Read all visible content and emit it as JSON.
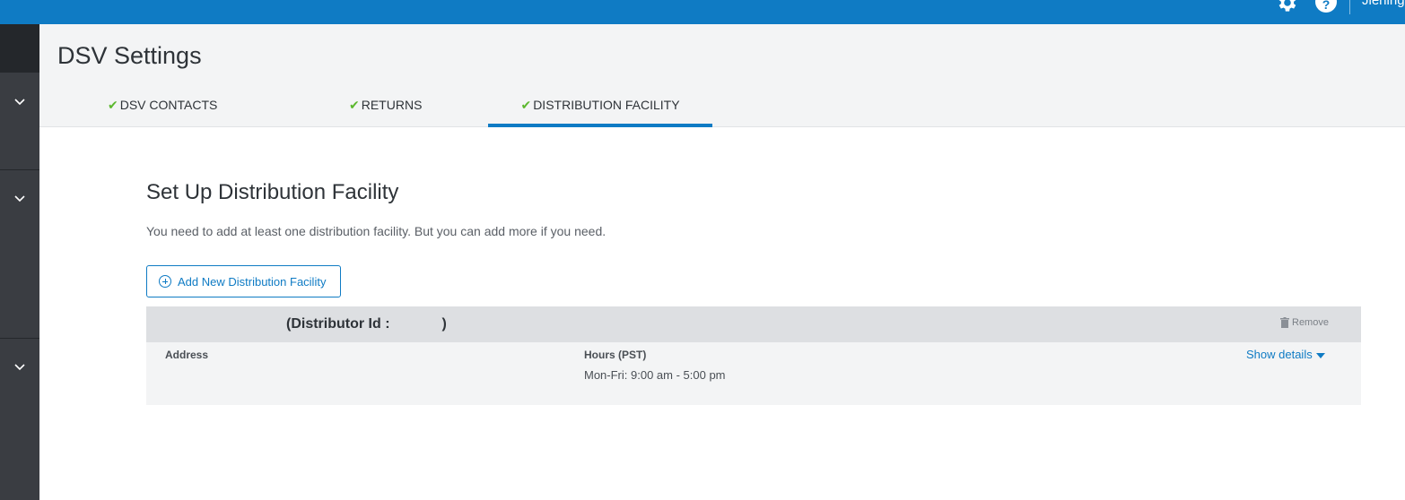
{
  "topbar": {
    "user_partial": "Jiening"
  },
  "page": {
    "title": "DSV Settings"
  },
  "tabs": [
    {
      "label": "DSV CONTACTS",
      "complete": true,
      "active": false
    },
    {
      "label": "RETURNS",
      "complete": true,
      "active": false
    },
    {
      "label": "DISTRIBUTION FACILITY",
      "complete": true,
      "active": true
    }
  ],
  "section": {
    "title": "Set Up Distribution Facility",
    "description": "You need to add at least one distribution facility. But you can add more if you need.",
    "add_button_label": "Add New Distribution Facility"
  },
  "facility": {
    "title_prefix": "(Distributor Id :",
    "title_suffix": ")",
    "remove_label": "Remove",
    "address_label": "Address",
    "hours_label": "Hours (PST)",
    "hours_value": "Mon-Fri: 9:00 am - 5:00 pm",
    "show_details_label": "Show details"
  },
  "colors": {
    "brand_blue": "#0f7bc4",
    "check_green": "#5cb82e",
    "sidebar": "#3a3d42"
  },
  "icons": [
    "gear-icon",
    "help-icon",
    "chevron-down-icon",
    "checkmark-icon",
    "add-circle-icon",
    "trash-icon",
    "caret-down-icon"
  ]
}
